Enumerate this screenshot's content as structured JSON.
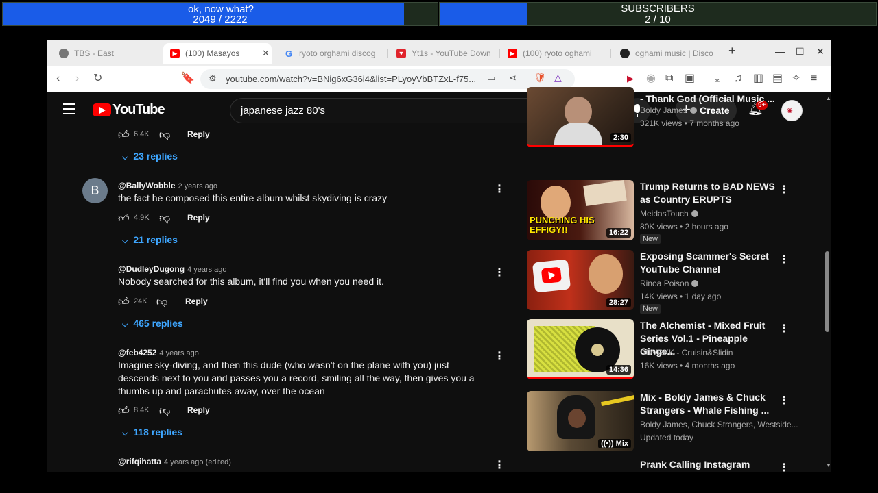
{
  "stream_bars": {
    "left": {
      "title": "ok, now what?",
      "count": "2049  /  2222",
      "progress": 0.923
    },
    "right": {
      "title": "SUBSCRIBERS",
      "count": "2 / 10",
      "progress": 0.2
    }
  },
  "browser": {
    "tabs": [
      {
        "label": "TBS - East",
        "icon": "globe-icon"
      },
      {
        "label": "(100) Masayos",
        "icon": "youtube-icon",
        "active": true
      },
      {
        "label": "ryoto orghami discog",
        "icon": "google-icon"
      },
      {
        "label": "Yt1s - YouTube Down",
        "icon": "yt1s-icon"
      },
      {
        "label": "(100) ryoto oghami",
        "icon": "youtube-icon"
      },
      {
        "label": "oghami music | Disco",
        "icon": "discogs-icon"
      }
    ],
    "url": "youtube.com/watch?v=BNig6xG36i4&list=PLyoyVbBTZxL-f75..."
  },
  "youtube": {
    "logo_text": "YouTube",
    "search_value": "japanese jazz 80's",
    "create_label": "Create",
    "notif_badge": "9+",
    "comments": [
      {
        "handle": "",
        "age": "",
        "text": "",
        "likes": "6.4K",
        "replies": "23 replies",
        "reply_label": "Reply"
      },
      {
        "handle": "@BallyWobble",
        "age": "2 years ago",
        "text": "the fact he composed this entire album whilst skydiving is crazy",
        "likes": "4.9K",
        "replies": "21 replies",
        "reply_label": "Reply",
        "avatar_letter": "B"
      },
      {
        "handle": "@DudleyDugong",
        "age": "4 years ago",
        "text": "Nobody searched for this album, it'll find you when you need it.",
        "likes": "24K",
        "replies": "465 replies",
        "reply_label": "Reply"
      },
      {
        "handle": "@feb4252",
        "age": "4 years ago",
        "text": "Imagine sky-diving, and then this dude (who wasn't on the plane with you) just descends next to you and passes you a record, smiling all the way, then gives you a thumbs up and parachutes away, over the ocean",
        "likes": "8.4K",
        "replies": "118 replies",
        "reply_label": "Reply"
      },
      {
        "handle": "@rifqihatta",
        "age": "4 years ago (edited)"
      }
    ],
    "related": [
      {
        "title": "- Thank God (Official Music ...",
        "channel": "Boldy James",
        "meta": "321K views • 7 months ago",
        "duration": "2:30",
        "verified": true
      },
      {
        "title": "Trump Returns to BAD NEWS as Country ERUPTS",
        "channel": "MeidasTouch",
        "meta": "80K views • 2 hours ago",
        "duration": "16:22",
        "badge": "New",
        "verified": true,
        "thumb_text": "PUNCHING HIS EFFIGY!!"
      },
      {
        "title": "Exposing Scammer's Secret YouTube Channel",
        "channel": "Rinoa Poison",
        "meta": "14K views • 1 day ago",
        "duration": "28:27",
        "badge": "New",
        "verified": true
      },
      {
        "title": "The Alchemist - Mixed Fruit Series Vol.1 - Pineapple Ginge...",
        "channel": "DDVRKK - Cruisin&Slidin",
        "meta": "16K views • 4 months ago",
        "duration": "14:36"
      },
      {
        "title": "Mix - Boldy James & Chuck Strangers - Whale Fishing ...",
        "channel": "Boldy James, Chuck Strangers, Westside...",
        "meta": "Updated today",
        "duration": "Mix"
      },
      {
        "title": "Prank Calling Instagram Money"
      }
    ]
  }
}
